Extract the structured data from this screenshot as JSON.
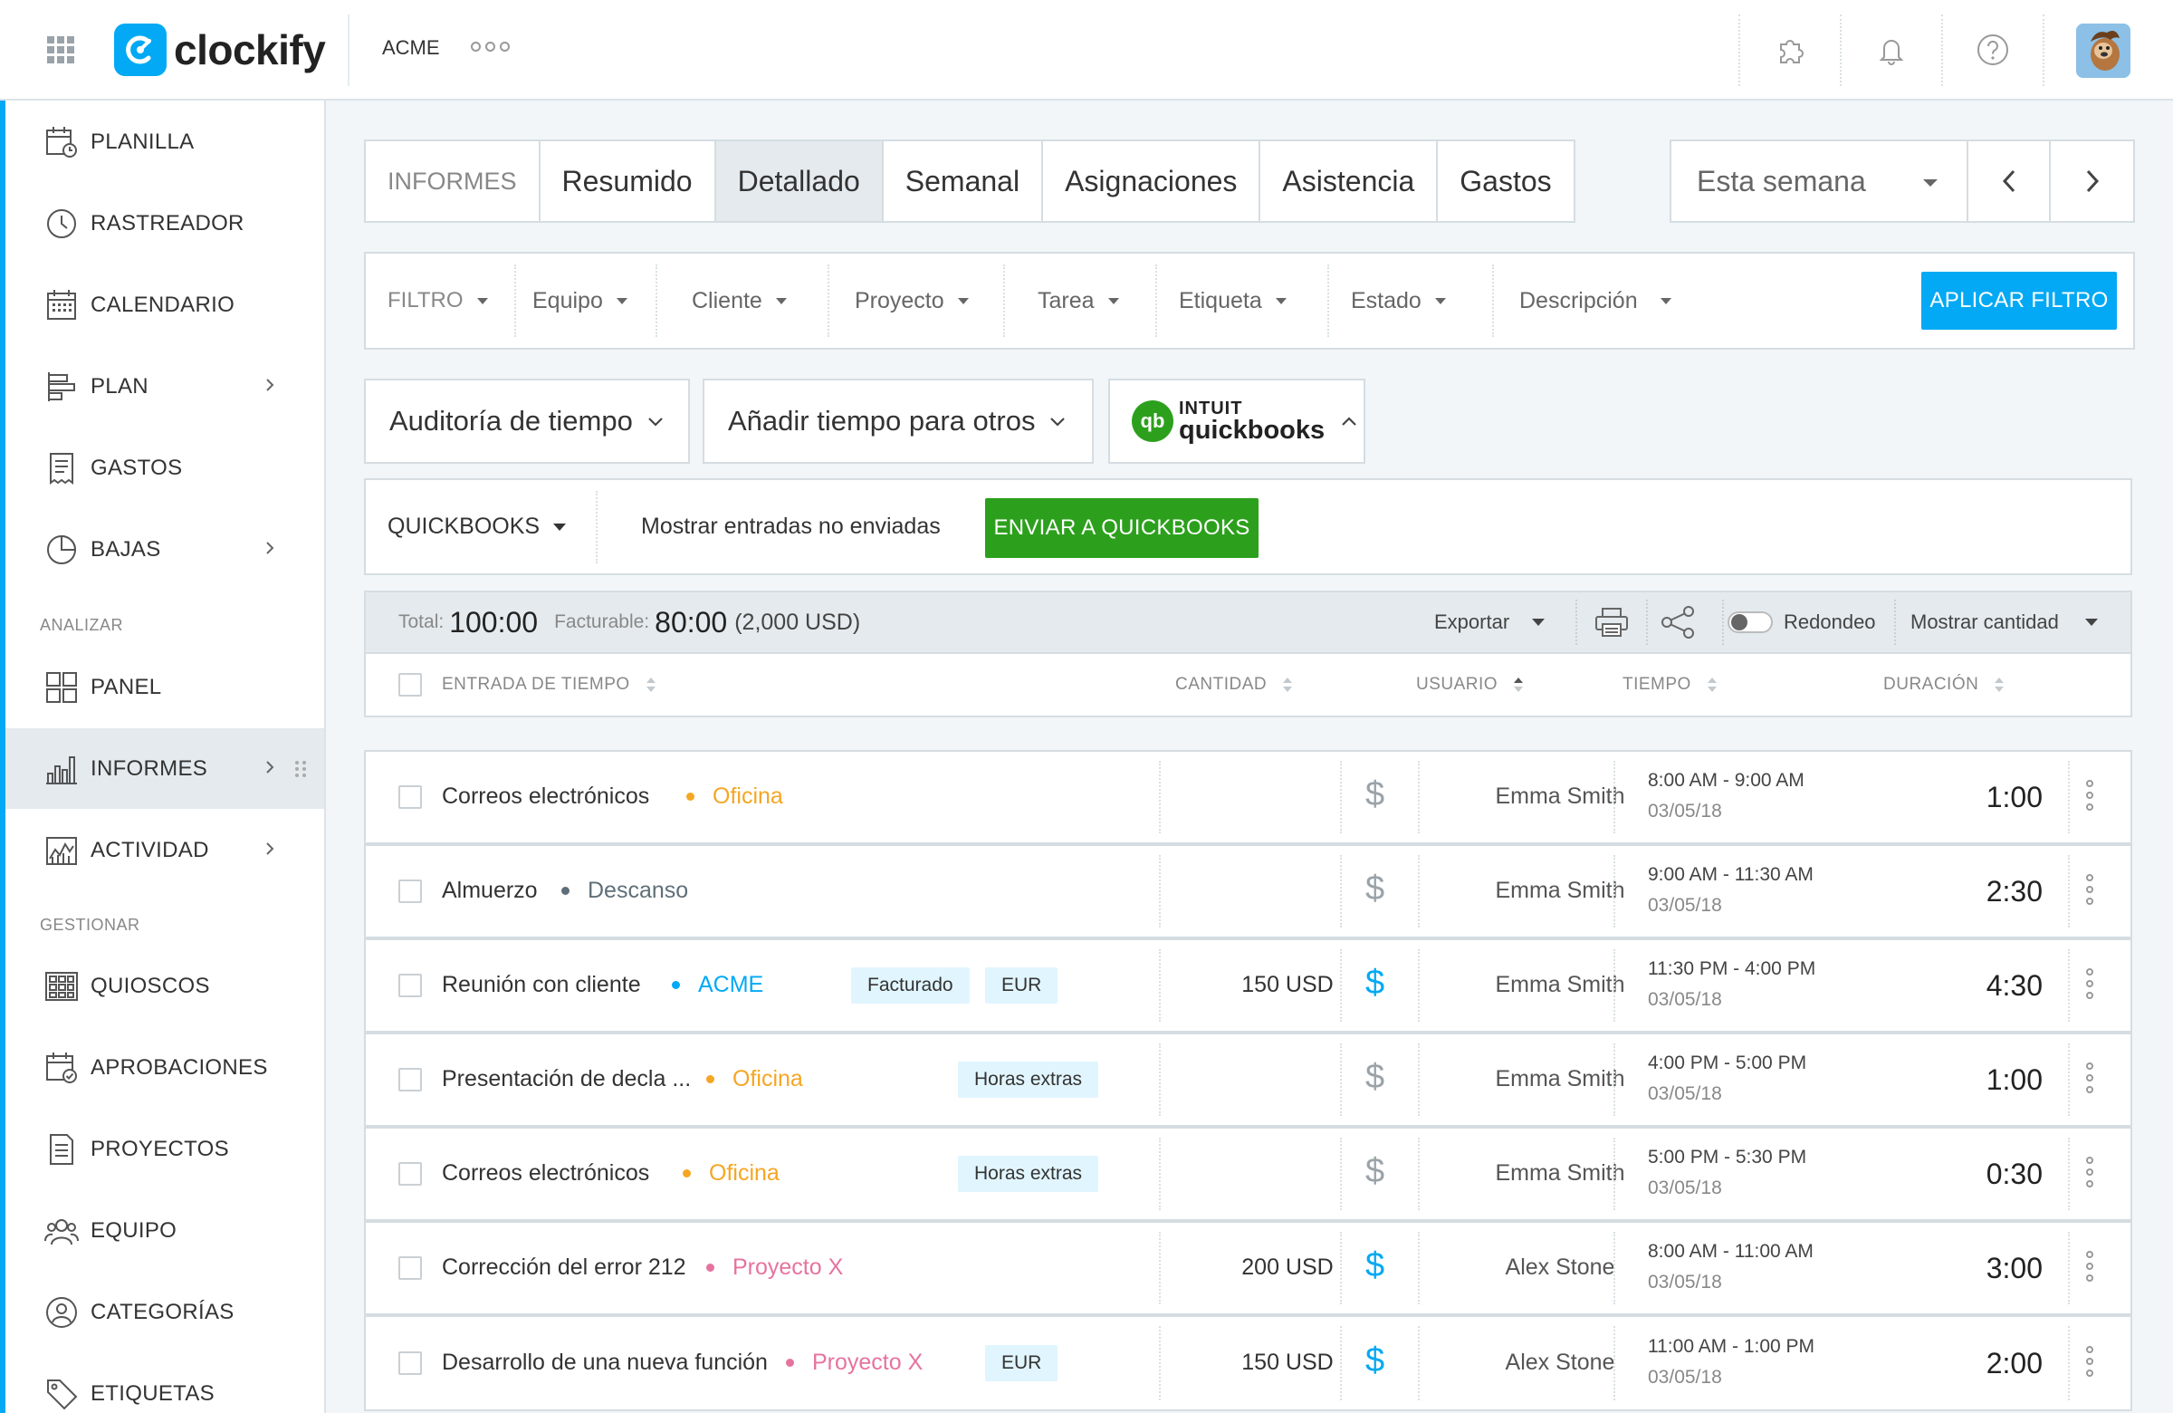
{
  "app": {
    "brand": "clockify",
    "workspace": "ACME",
    "colors": {
      "primary": "#03a9f4",
      "quickbooks_green": "#2ca01c",
      "accent_orange": "#f5a623",
      "accent_pink": "#e6739f",
      "accent_blue": "#03a9f4",
      "break_gray": "#5f6f78"
    }
  },
  "topbar": {
    "icons": [
      "apps-grid-icon",
      "addons-puzzle-icon",
      "bell-icon",
      "help-icon",
      "user-avatar"
    ]
  },
  "sidebar": {
    "items": [
      {
        "label": "PLANILLA",
        "icon": "timesheet-icon",
        "chevron": false
      },
      {
        "label": "RASTREADOR",
        "icon": "clock-icon",
        "chevron": false
      },
      {
        "label": "CALENDARIO",
        "icon": "calendar-icon",
        "chevron": false
      },
      {
        "label": "PLAN",
        "icon": "schedule-icon",
        "chevron": true
      },
      {
        "label": "GASTOS",
        "icon": "receipt-icon",
        "chevron": false
      },
      {
        "label": "BAJAS",
        "icon": "time-off-icon",
        "chevron": true
      }
    ],
    "section_analyze": "ANALIZAR",
    "analyze_items": [
      {
        "label": "PANEL",
        "icon": "dashboard-icon",
        "chevron": false
      },
      {
        "label": "INFORMES",
        "icon": "bar-chart-icon",
        "chevron": true,
        "active": true
      },
      {
        "label": "ACTIVIDAD",
        "icon": "activity-icon",
        "chevron": true
      }
    ],
    "section_manage": "GESTIONAR",
    "manage_items": [
      {
        "label": "QUIOSCOS",
        "icon": "kiosk-icon"
      },
      {
        "label": "APROBACIONES",
        "icon": "approval-icon"
      },
      {
        "label": "PROYECTOS",
        "icon": "document-icon"
      },
      {
        "label": "EQUIPO",
        "icon": "team-icon"
      },
      {
        "label": "CATEGORÍAS",
        "icon": "category-icon"
      },
      {
        "label": "ETIQUETAS",
        "icon": "tag-icon"
      }
    ]
  },
  "tabs": {
    "label": "INFORMES",
    "items": [
      "Resumido",
      "Detallado",
      "Semanal",
      "Asignaciones",
      "Asistencia",
      "Gastos"
    ],
    "active": "Detallado"
  },
  "range": {
    "value": "Esta semana"
  },
  "filters": {
    "label": "FILTRO",
    "items": [
      "Equipo",
      "Cliente",
      "Proyecto",
      "Tarea",
      "Etiqueta",
      "Estado",
      "Descripción"
    ],
    "apply": "APLICAR FILTRO"
  },
  "extras": {
    "audit": "Auditoría de tiempo",
    "add_time": "Añadir tiempo para otros",
    "qb_intuit": "INTUIT",
    "qb_name": "quickbooks"
  },
  "qb": {
    "select": "QUICKBOOKS",
    "show": "Mostrar entradas no enviadas",
    "send": "ENVIAR A QUICKBOOKS"
  },
  "summary": {
    "total_label": "Total:",
    "total": "100:00",
    "billable_label": "Facturable:",
    "billable": "80:00",
    "billable_usd": "(2,000 USD)",
    "export": "Exportar",
    "rounding": "Redondeo",
    "show_amount": "Mostrar cantidad"
  },
  "table": {
    "headers": {
      "entry": "ENTRADA DE TIEMPO",
      "amount": "CANTIDAD",
      "user": "USUARIO",
      "time": "TIEMPO",
      "duration": "DURACIÓN"
    },
    "rows": [
      {
        "description": "Correos electrónicos",
        "project": "Oficina",
        "project_color": "#f5a623",
        "tags": [],
        "amount": "",
        "billable": false,
        "user": "Emma Smith",
        "time_range": "8:00 AM - 9:00 AM",
        "date": "03/05/18",
        "duration": "1:00"
      },
      {
        "description": "Almuerzo",
        "project": "Descanso",
        "project_color": "#5f6f78",
        "tags": [],
        "amount": "",
        "billable": false,
        "user": "Emma Smith",
        "time_range": "9:00 AM - 11:30 AM",
        "date": "03/05/18",
        "duration": "2:30"
      },
      {
        "description": "Reunión con cliente",
        "project": "ACME",
        "project_color": "#03a9f4",
        "tags": [
          "Facturado",
          "EUR"
        ],
        "amount": "150 USD",
        "billable": true,
        "user": "Emma Smith",
        "time_range": "11:30 PM - 4:00 PM",
        "date": "03/05/18",
        "duration": "4:30"
      },
      {
        "description": "Presentación de decla ...",
        "project": "Oficina",
        "project_color": "#f5a623",
        "tags": [
          "Horas extras"
        ],
        "amount": "",
        "billable": false,
        "user": "Emma Smith",
        "time_range": "4:00 PM - 5:00 PM",
        "date": "03/05/18",
        "duration": "1:00"
      },
      {
        "description": "Correos electrónicos",
        "project": "Oficina",
        "project_color": "#f5a623",
        "tags": [
          "Horas extras"
        ],
        "amount": "",
        "billable": false,
        "user": "Emma Smith",
        "time_range": "5:00 PM - 5:30 PM",
        "date": "03/05/18",
        "duration": "0:30"
      },
      {
        "description": "Corrección del error 212",
        "project": "Proyecto X",
        "project_color": "#e6739f",
        "tags": [],
        "amount": "200 USD",
        "billable": true,
        "user": "Alex Stone",
        "time_range": "8:00 AM - 11:00 AM",
        "date": "03/05/18",
        "duration": "3:00"
      },
      {
        "description": "Desarrollo de una nueva función",
        "project": "Proyecto X",
        "project_color": "#e6739f",
        "tags": [
          "EUR"
        ],
        "amount": "150 USD",
        "billable": true,
        "user": "Alex Stone",
        "time_range": "11:00 AM - 1:00 PM",
        "date": "03/05/18",
        "duration": "2:00"
      }
    ]
  }
}
